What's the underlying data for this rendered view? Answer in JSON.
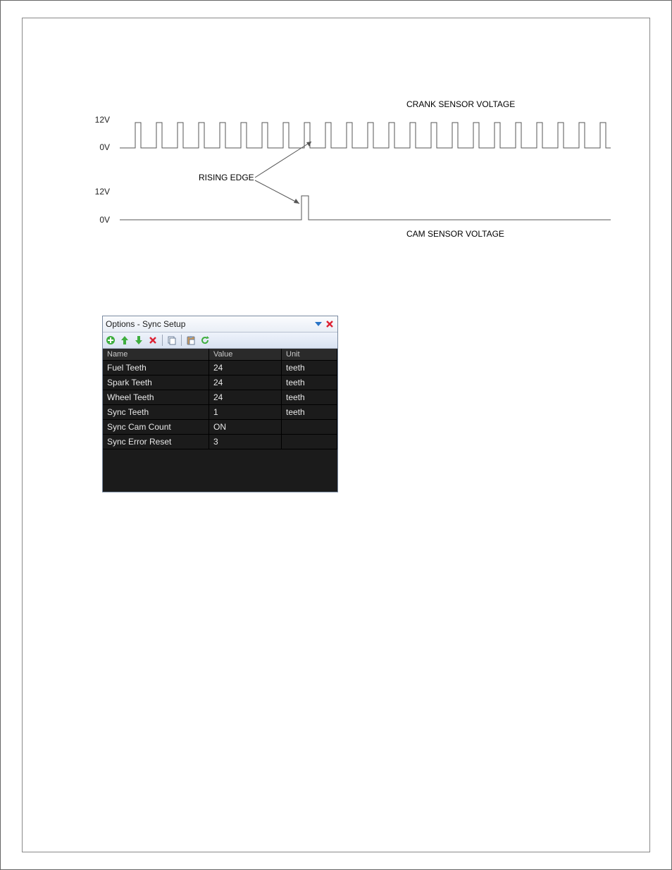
{
  "scope": {
    "crank_label": "CRANK SENSOR VOLTAGE",
    "cam_label": "CAM SENSOR VOLTAGE",
    "rising_edge": "RISING EDGE",
    "v12_a": "12V",
    "v0_a": "0V",
    "v12_b": "12V",
    "v0_b": "0V"
  },
  "panel": {
    "title": "Options - Sync Setup",
    "columns": {
      "name": "Name",
      "value": "Value",
      "unit": "Unit"
    },
    "rows": [
      {
        "name": "Fuel Teeth",
        "value": "24",
        "unit": "teeth"
      },
      {
        "name": "Spark Teeth",
        "value": "24",
        "unit": "teeth"
      },
      {
        "name": "Wheel Teeth",
        "value": "24",
        "unit": "teeth"
      },
      {
        "name": "Sync Teeth",
        "value": "1",
        "unit": "teeth"
      },
      {
        "name": "Sync Cam Count",
        "value": "ON",
        "unit": ""
      },
      {
        "name": "Sync Error Reset",
        "value": "3",
        "unit": ""
      }
    ]
  },
  "icons": {
    "dropdown": "dropdown-icon",
    "close": "close-icon",
    "add": "add-icon",
    "up": "up-arrow-icon",
    "down": "down-arrow-icon",
    "delete": "delete-icon",
    "copy": "copy-icon",
    "paste": "paste-icon",
    "refresh": "refresh-icon"
  }
}
